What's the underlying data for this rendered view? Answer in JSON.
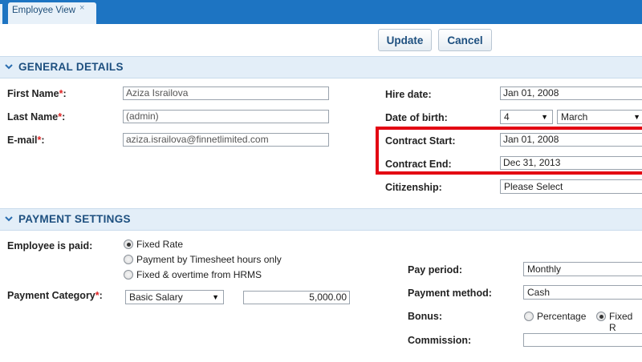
{
  "tab": {
    "label": "Employee View",
    "close": "×"
  },
  "toolbar": {
    "update_label": "Update",
    "cancel_label": "Cancel"
  },
  "general": {
    "title": "GENERAL DETAILS",
    "first_name_label": "First Name",
    "first_name_value": "Aziza Israilova",
    "last_name_label": "Last Name",
    "last_name_value": "(admin)",
    "email_label": "E-mail",
    "email_value": "aziza.israilova@finnetlimited.com",
    "hire_date_label": "Hire date:",
    "hire_date_value": "Jan 01, 2008",
    "dob_label": "Date of birth:",
    "dob_day": "4",
    "dob_month": "March",
    "contract_start_label": "Contract Start:",
    "contract_start_value": "Jan 01, 2008",
    "contract_end_label": "Contract End:",
    "contract_end_value": "Dec 31, 2013",
    "citizenship_label": "Citizenship:",
    "citizenship_value": "Please Select"
  },
  "payment": {
    "title": "PAYMENT SETTINGS",
    "paid_label": "Employee is paid:",
    "options": [
      "Fixed Rate",
      "Payment by Timesheet hours only",
      "Fixed & overtime from HRMS"
    ],
    "selected_option": "Fixed Rate",
    "category_label": "Payment Category",
    "category_value": "Basic Salary",
    "amount_value": "5,000.00",
    "pay_period_label": "Pay period:",
    "pay_period_value": "Monthly",
    "method_label": "Payment method:",
    "method_value": "Cash",
    "bonus_label": "Bonus:",
    "bonus_options": [
      "Percentage",
      "Fixed R"
    ],
    "bonus_selected": "Fixed R",
    "commission_label": "Commission:",
    "commission_value": ""
  },
  "colors": {
    "tabbar": "#1d74c2",
    "section_bg": "#e3eef8",
    "heading": "#1d4f7f",
    "highlight": "#e30613",
    "required": "#dd2222"
  }
}
